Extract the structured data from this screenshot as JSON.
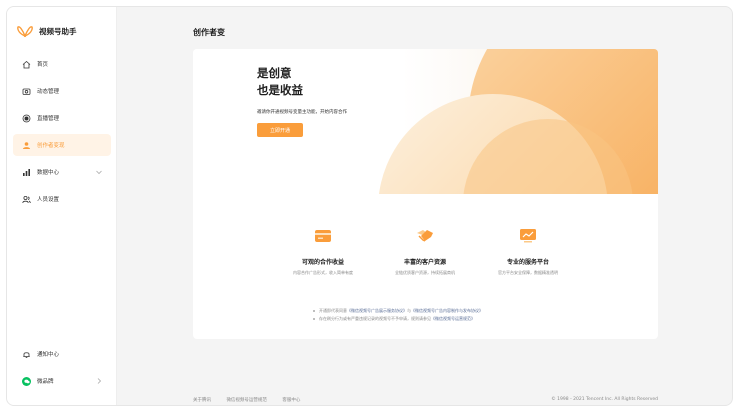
{
  "app": {
    "name": "视频号助手"
  },
  "sidebar": {
    "items": [
      {
        "label": "首页",
        "icon": "home-icon",
        "active": false
      },
      {
        "label": "动态管理",
        "icon": "camera-icon",
        "active": false
      },
      {
        "label": "直播管理",
        "icon": "live-dot-icon",
        "active": false
      },
      {
        "label": "创作者变现",
        "icon": "creator-icon",
        "active": true
      },
      {
        "label": "数据中心",
        "icon": "bar-chart-icon",
        "active": false
      },
      {
        "label": "人员设置",
        "icon": "people-icon",
        "active": false
      }
    ],
    "bottom": [
      {
        "label": "通知中心",
        "icon": "bell-icon"
      },
      {
        "label": "微品牌",
        "icon": "wechat-icon"
      }
    ]
  },
  "page": {
    "title": "创作者变"
  },
  "hero": {
    "line1": "是创意",
    "line2": "也是收益",
    "desc": "邀请你开通视频号变量主功能，开始内容合作",
    "cta": "立即开通"
  },
  "features": [
    {
      "title": "可观的合作收益",
      "desc": "内容合作广告形式，收入简单有度",
      "icon": "card-icon"
    },
    {
      "title": "丰富的客户资源",
      "desc": "全链优质客户资源，持续拓展商机",
      "icon": "handshake-icon"
    },
    {
      "title": "专业的服务平台",
      "desc": "官方平台安全保障，数据精准透明",
      "icon": "chart-screen-icon"
    }
  ],
  "notes": [
    {
      "prefix": "开通即代表同意",
      "link1": "《微信视频号广告展示服务协议》",
      "mid": "与",
      "link2": "《微信视频号广告内容制作与发布协议》"
    },
    {
      "prefix": "存在刷分行为或有严重违规记录的视频号不予申请，规则请参见",
      "link1": "《微信视频号运营规范》",
      "mid": "",
      "link2": ""
    }
  ],
  "footer": {
    "links": [
      "关于腾讯",
      "微信视频号运营规范",
      "客服中心"
    ],
    "copyright": "© 1998 - 2021 Tencent Inc. All Rights Reserved"
  },
  "colors": {
    "accent": "#fa9d3b",
    "link": "#576b95"
  }
}
